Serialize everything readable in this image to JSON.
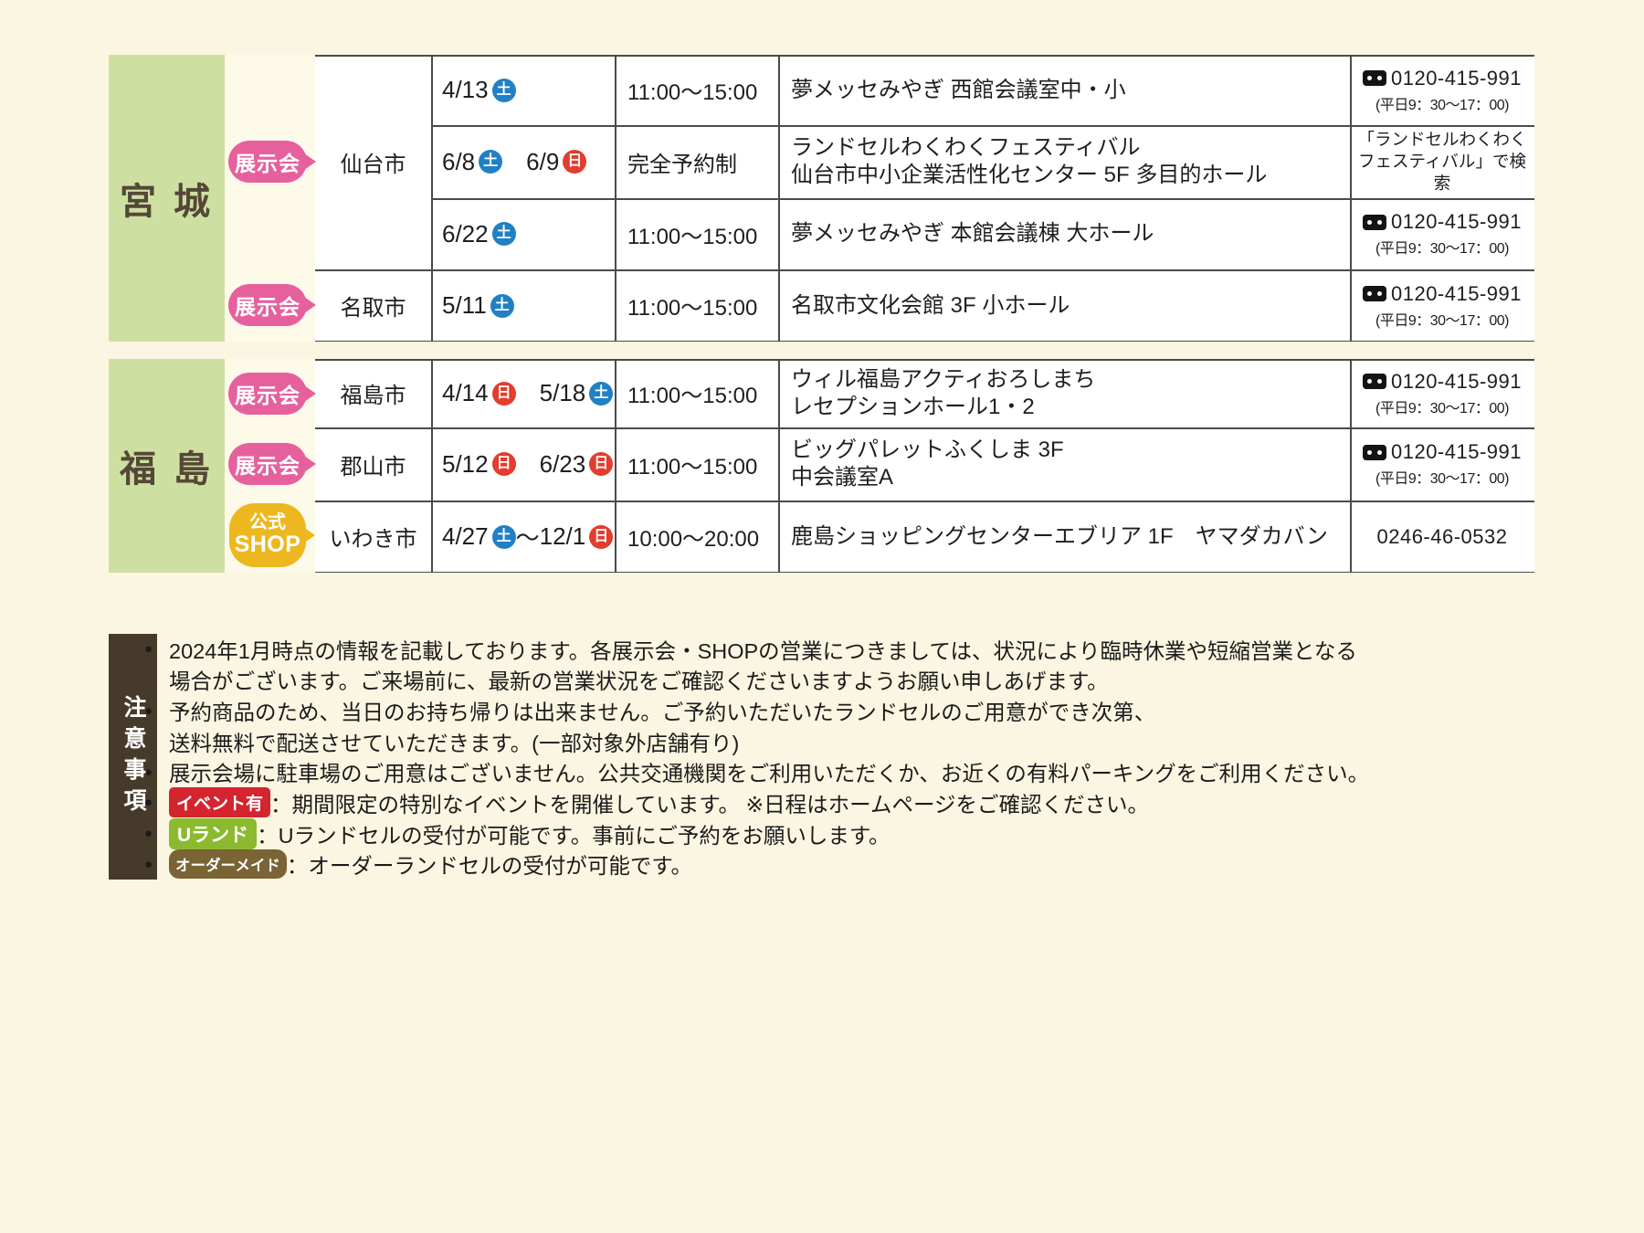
{
  "colors": {
    "page_bg": "#fbf6e1",
    "prefecture_green": "#cde0a1",
    "badge_pink": "#e6609e",
    "badge_yellow": "#edb71f",
    "saturday_blue": "#2180c4",
    "sunday_red": "#e23d2e",
    "note_sidebar_brown": "#463a2b",
    "event_badge_red": "#d42430",
    "uland_badge_green": "#8cba2e",
    "order_badge_brown": "#7a6335"
  },
  "prefectures": [
    "宮 城",
    "福 島"
  ],
  "badges": {
    "exhibition": "展示会",
    "shop_top": "公式",
    "shop_bottom": "SHOP"
  },
  "cities": [
    "仙台市",
    "名取市",
    "福島市",
    "郡山市",
    "いわき市"
  ],
  "rows": [
    {
      "d1": "4/13",
      "w1": "土",
      "w1c": "day sat",
      "sep": "",
      "d2": "",
      "w2": "",
      "w2c": "hid",
      "time": "11:00～15:00",
      "v1": "夢メッセみやぎ 西館会議室中・小",
      "v2": "",
      "phone_num": "0120-415-991",
      "phone_hours": "(平日9：30～17：00)"
    },
    {
      "d1": "6/8",
      "w1": "土",
      "w1c": "day sat",
      "sep": "　",
      "d2": "6/9",
      "w2": "日",
      "w2c": "day sun",
      "time": "完全予約制",
      "v1": "ランドセルわくわくフェスティバル",
      "v2": "仙台市中小企業活性化センター 5F 多目的ホール",
      "search1": "「ランドセルわくわく",
      "search2": "フェスティバル」で検索"
    },
    {
      "d1": "6/22",
      "w1": "土",
      "w1c": "day sat",
      "sep": "",
      "d2": "",
      "w2": "",
      "w2c": "hid",
      "time": "11:00～15:00",
      "v1": "夢メッセみやぎ 本館会議棟 大ホール",
      "v2": "",
      "phone_num": "0120-415-991",
      "phone_hours": "(平日9：30～17：00)"
    },
    {
      "d1": "5/11",
      "w1": "土",
      "w1c": "day sat",
      "sep": "",
      "d2": "",
      "w2": "",
      "w2c": "hid",
      "time": "11:00～15:00",
      "v1": "名取市文化会館 3F 小ホール",
      "v2": "",
      "phone_num": "0120-415-991",
      "phone_hours": "(平日9：30～17：00)"
    },
    {
      "d1": "4/14",
      "w1": "日",
      "w1c": "day sun",
      "sep": "　",
      "d2": "5/18",
      "w2": "土",
      "w2c": "day sat",
      "time": "11:00～15:00",
      "v1": "ウィル福島アクティおろしまち",
      "v2": "レセプションホール1・2",
      "phone_num": "0120-415-991",
      "phone_hours": "(平日9：30～17：00)"
    },
    {
      "d1": "5/12",
      "w1": "日",
      "w1c": "day sun",
      "sep": "　",
      "d2": "6/23",
      "w2": "日",
      "w2c": "day sun",
      "time": "11:00～15:00",
      "v1": "ビッグパレットふくしま 3F",
      "v2": "中会議室A",
      "phone_num": "0120-415-991",
      "phone_hours": "(平日9：30～17：00)"
    },
    {
      "d1": "4/27",
      "w1": "土",
      "w1c": "day sat",
      "sep": "～",
      "d2": "12/1",
      "w2": "日",
      "w2c": "day sun",
      "time": "10:00～20:00",
      "v1": "鹿島ショッピングセンターエブリア 1F　ヤマダカバン",
      "v2": "",
      "phone_num": "0246-46-0532"
    }
  ],
  "notes": {
    "sidebar": "注意事項",
    "lines": [
      {
        "bullet": "●",
        "badge": "",
        "badge_class": "nb",
        "text": "2024年1月時点の情報を記載しております。各展示会・SHOPの営業につきましては、状況により臨時休業や短縮営業となる"
      },
      {
        "bullet": "",
        "badge": "",
        "badge_class": "nb",
        "text": "場合がございます。ご来場前に、最新の営業状況をご確認くださいますようお願い申しあげます。"
      },
      {
        "bullet": "●",
        "badge": "",
        "badge_class": "nb",
        "text": "予約商品のため、当日のお持ち帰りは出来ません。ご予約いただいたランドセルのご用意ができ次第、"
      },
      {
        "bullet": "",
        "badge": "",
        "badge_class": "nb",
        "text": "送料無料で配送させていただきます。(一部対象外店舗有り)"
      },
      {
        "bullet": "●",
        "badge": "",
        "badge_class": "nb",
        "text": "展示会場に駐車場のご用意はございません。公共交通機関をご利用いただくか、お近くの有料パーキングをご利用ください。"
      },
      {
        "bullet": "●",
        "badge": "イベント有",
        "badge_class": "nb nb-event",
        "text": "：期間限定の特別なイベントを開催しています。 ※日程はホームページをご確認ください。"
      },
      {
        "bullet": "●",
        "badge": "Uランド",
        "badge_class": "nb nb-uland",
        "text": "：Uランドセルの受付が可能です。事前にご予約をお願いします。"
      },
      {
        "bullet": "●",
        "badge": "オーダーメイド",
        "badge_class": "nb nb-order",
        "text": "：オーダーランドセルの受付が可能です。"
      }
    ]
  }
}
